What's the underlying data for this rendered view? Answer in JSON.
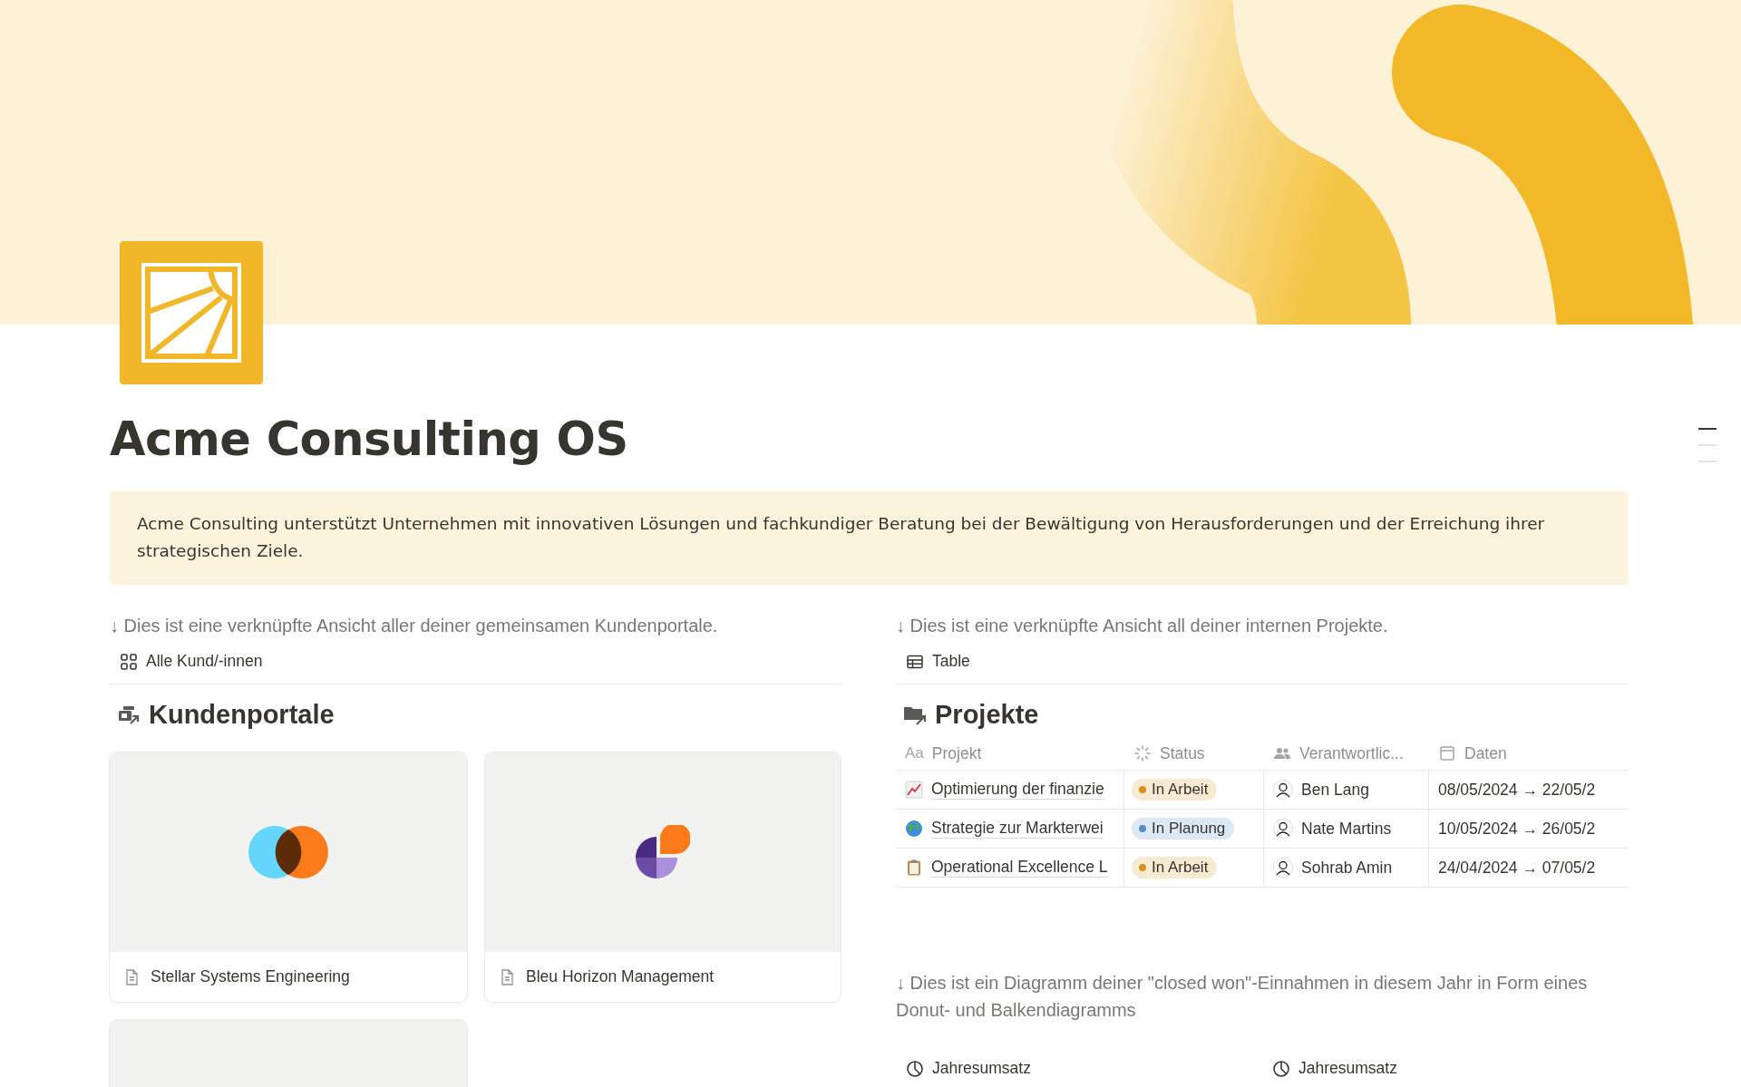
{
  "title": "Acme Consulting OS",
  "callout": "Acme Consulting unterstützt Unternehmen mit innovativen Lösungen und fachkundiger Beratung bei der Bewältigung von Herausforderungen und der Erreichung ihrer strategischen Ziele.",
  "outline": [
    {
      "selected": true
    },
    {
      "selected": false
    },
    {
      "selected": false
    }
  ],
  "left": {
    "hint": "↓ Dies ist eine verknüpfte Ansicht aller deiner gemeinsamen Kundenportale.",
    "view_tab": "Alle Kund/-innen",
    "heading": "Kundenportale",
    "cards": [
      {
        "kind": "venn",
        "title": "Stellar Systems Engineering"
      },
      {
        "kind": "quarters",
        "title": "Bleu Horizon Management"
      },
      {
        "kind": "blank"
      }
    ]
  },
  "right": {
    "hint": "↓ Dies ist eine verknüpfte Ansicht all deiner internen Projekte.",
    "view_tab": "Table",
    "heading": "Projekte",
    "columns": [
      {
        "kind": "title",
        "type_label": "Aa",
        "label": "Projekt"
      },
      {
        "kind": "status",
        "label": "Status"
      },
      {
        "kind": "people",
        "label": "Verantwortlic..."
      },
      {
        "kind": "date",
        "label": "Daten"
      }
    ],
    "rows": [
      {
        "kind": "chart",
        "project": "Optimierung der finanzie",
        "status": {
          "label": "In Arbeit",
          "color": "#d9911c"
        },
        "owner": "Ben Lang",
        "dates": "08/05/2024 → 22/05/2"
      },
      {
        "kind": "globe",
        "project": "Strategie zur Markterwei",
        "status": {
          "label": "In Planung",
          "color": "#4e8fc7"
        },
        "owner": "Nate Martins",
        "dates": "10/05/2024 → 26/05/2"
      },
      {
        "kind": "clipboard",
        "project": "Operational Excellence L",
        "status": {
          "label": "In Arbeit",
          "color": "#d9911c"
        },
        "owner": "Sohrab Amin",
        "dates": "24/04/2024 → 07/05/2"
      }
    ],
    "chart_hint": "↓ Dies ist ein Diagramm deiner \"closed won\"-Einnahmen in diesem Jahr in Form eines Donut- und Balkendiagramms",
    "chart_tabs": [
      "Jahresumsatz",
      "Jahresumsatz"
    ]
  }
}
